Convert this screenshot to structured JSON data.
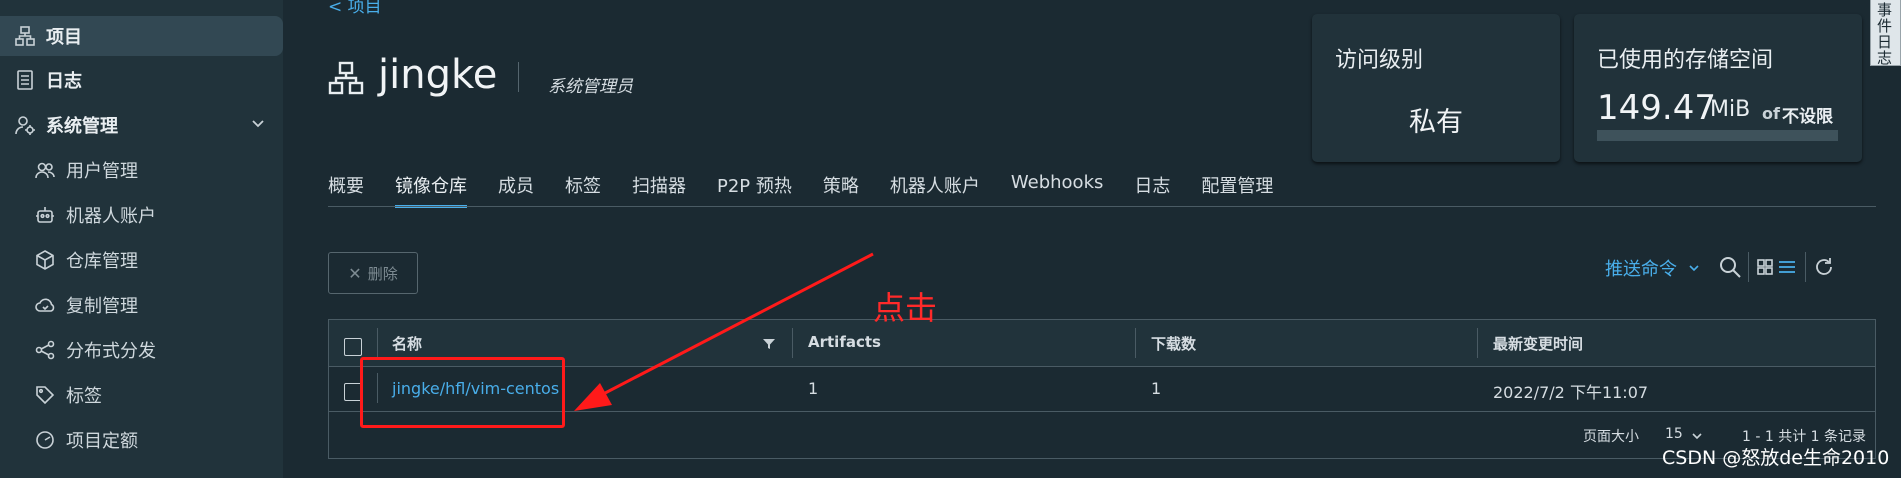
{
  "sidebar": {
    "items": [
      {
        "label": "项目",
        "icon": "project-icon",
        "active": true
      },
      {
        "label": "日志",
        "icon": "log-icon"
      },
      {
        "label": "系统管理",
        "icon": "admin-icon"
      },
      {
        "label": "用户管理",
        "icon": "users-icon"
      },
      {
        "label": "机器人账户",
        "icon": "robot-icon"
      },
      {
        "label": "仓库管理",
        "icon": "registry-icon"
      },
      {
        "label": "复制管理",
        "icon": "replication-icon"
      },
      {
        "label": "分布式分发",
        "icon": "distribution-icon"
      },
      {
        "label": "标签",
        "icon": "tag-icon"
      },
      {
        "label": "项目定额",
        "icon": "quota-icon"
      }
    ]
  },
  "header": {
    "back_label": "< 项目",
    "project_name": "jingke",
    "role": "系统管理员"
  },
  "cards": {
    "access": {
      "title": "访问级别",
      "value": "私有"
    },
    "storage": {
      "title": "已使用的存储空间",
      "value": "149.47",
      "unit": "MiB",
      "of": "of",
      "limit": "不设限",
      "usage_fraction": 0.0
    }
  },
  "side_tab": {
    "label": "事件日志"
  },
  "tabs": [
    {
      "label": "概要"
    },
    {
      "label": "镜像仓库",
      "active": true
    },
    {
      "label": "成员"
    },
    {
      "label": "标签"
    },
    {
      "label": "扫描器"
    },
    {
      "label": "P2P 预热"
    },
    {
      "label": "策略"
    },
    {
      "label": "机器人账户"
    },
    {
      "label": "Webhooks"
    },
    {
      "label": "日志"
    },
    {
      "label": "配置管理"
    }
  ],
  "toolbar": {
    "delete_label": "删除",
    "push_command_label": "推送命令"
  },
  "table": {
    "columns": [
      "名称",
      "Artifacts",
      "下载数",
      "最新变更时间"
    ],
    "rows": [
      {
        "name": "jingke/hfl/vim-centos",
        "artifacts": "1",
        "downloads": "1",
        "updated": "2022/7/2 下午11:07"
      }
    ],
    "footer": {
      "page_size_label": "页面大小",
      "page_size": "15",
      "summary": "1 - 1 共计 1 条记录"
    }
  },
  "annotation": {
    "text": "点击",
    "color": "#ff1a1a"
  },
  "watermark": "CSDN @怒放de生命2010",
  "colors": {
    "accent": "#49aeea",
    "background": "#1b2a32",
    "sidebar": "#21333b"
  }
}
